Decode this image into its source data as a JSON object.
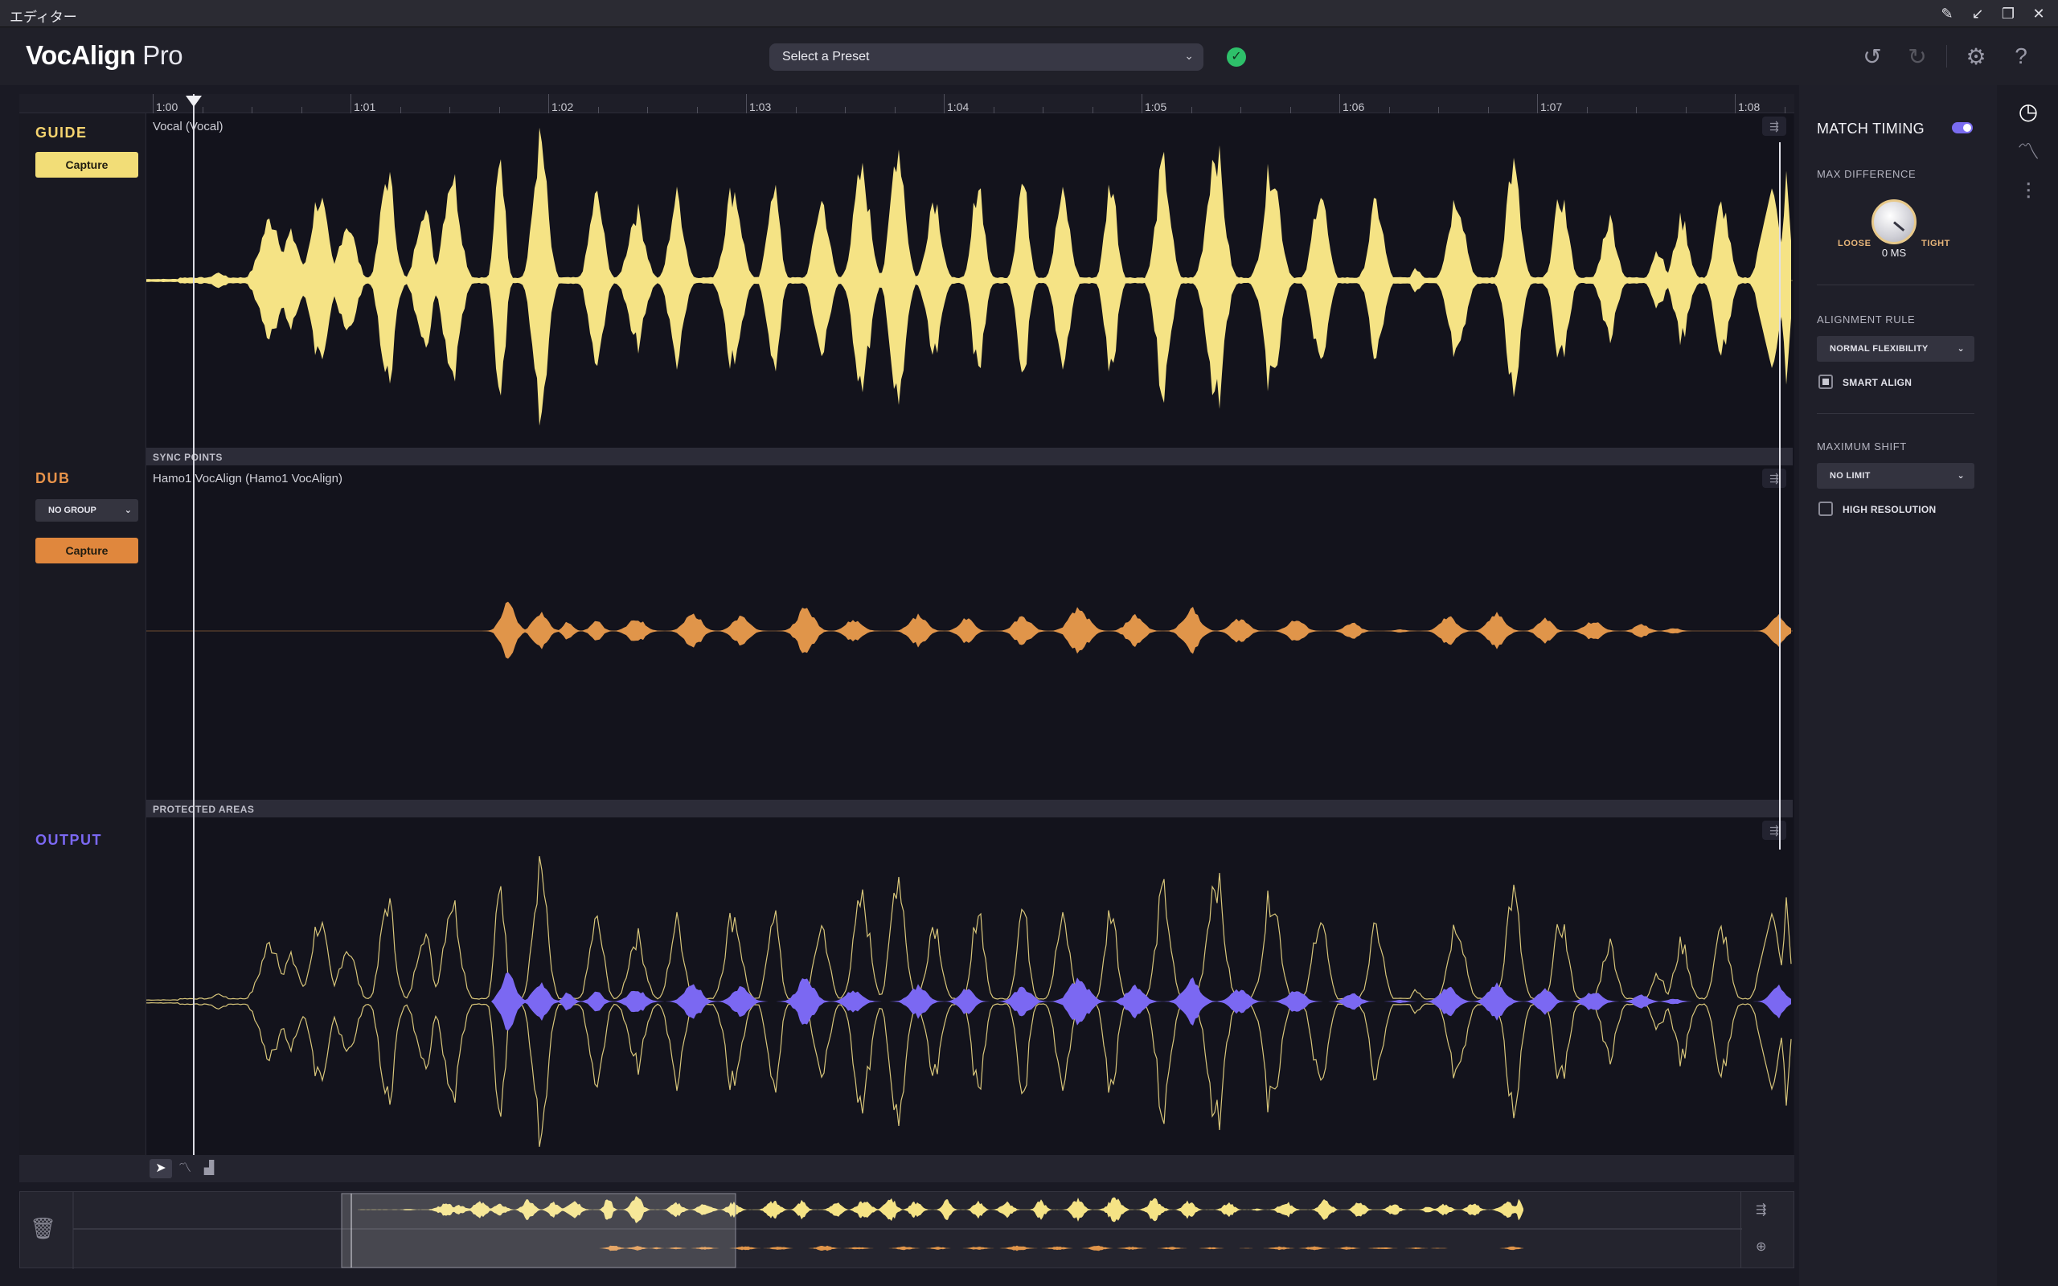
{
  "window": {
    "title": "エディター",
    "controls": [
      "pin",
      "minimize",
      "restore",
      "close"
    ]
  },
  "header": {
    "logo_bold": "VocAlign",
    "logo_light": "Pro",
    "preset_placeholder": "Select a Preset"
  },
  "ruler": {
    "ticks": [
      "1:00",
      "1:01",
      "1:02",
      "1:03",
      "1:04",
      "1:05",
      "1:06",
      "1:07",
      "1:08"
    ]
  },
  "tracks": {
    "guide": {
      "name": "GUIDE",
      "capture": "Capture",
      "clip": "Vocal (Vocal)",
      "color": "#f5e385"
    },
    "dub": {
      "name": "DUB",
      "group": "NO GROUP",
      "capture": "Capture",
      "clip": "Hamo1 VocAlign (Hamo1 VocAlign)",
      "color": "#e0954a"
    },
    "output": {
      "name": "OUTPUT",
      "color": "#7b68f2"
    }
  },
  "strips": {
    "sync_points": "SYNC POINTS",
    "protected_areas": "PROTECTED AREAS"
  },
  "panel": {
    "match_timing": {
      "label": "MATCH TIMING",
      "enabled": true
    },
    "max_difference": {
      "label": "MAX DIFFERENCE",
      "loose": "LOOSE",
      "tight": "TIGHT",
      "value": "0 MS"
    },
    "alignment_rule": {
      "label": "ALIGNMENT RULE",
      "value": "NORMAL FLEXIBILITY"
    },
    "smart_align": {
      "label": "SMART ALIGN",
      "checked": true
    },
    "maximum_shift": {
      "label": "MAXIMUM SHIFT",
      "value": "NO LIMIT"
    },
    "high_resolution": {
      "label": "HIGH RESOLUTION",
      "checked": false
    }
  },
  "colors": {
    "accent": "#7a6cf0",
    "guide": "#f5e385",
    "dub": "#e0954a",
    "output": "#7b68f2",
    "ok": "#2ec06a"
  }
}
